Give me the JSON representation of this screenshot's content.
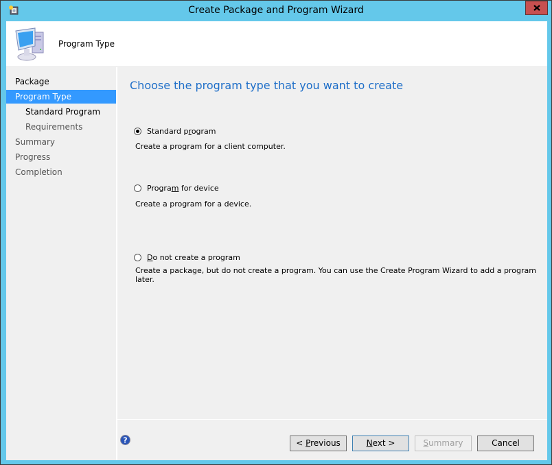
{
  "window": {
    "title": "Create Package and Program Wizard",
    "app_icon": "wizard-app-icon",
    "close_icon": "close-icon"
  },
  "header": {
    "icon": "computer-icon",
    "title": "Program Type"
  },
  "sidebar": {
    "items": [
      {
        "label": "Package",
        "state": "normal"
      },
      {
        "label": "Program Type",
        "state": "selected"
      },
      {
        "label": "Standard Program",
        "state": "sub"
      },
      {
        "label": "Requirements",
        "state": "sub-muted"
      },
      {
        "label": "Summary",
        "state": "muted"
      },
      {
        "label": "Progress",
        "state": "muted"
      },
      {
        "label": "Completion",
        "state": "muted"
      }
    ]
  },
  "main": {
    "heading": "Choose the program type that you want to create",
    "options": [
      {
        "label_pre": "Standard p",
        "label_accel": "r",
        "label_post": "ogram",
        "description": "Create a program for a client computer.",
        "checked": true
      },
      {
        "label_pre": "Progra",
        "label_accel": "m",
        "label_post": " for device",
        "description": "Create a program for a device.",
        "checked": false
      },
      {
        "label_pre": "",
        "label_accel": "D",
        "label_post": "o not create a program",
        "description": "Create a package, but do not create a program. You can use the Create Program Wizard to add a program later.",
        "checked": false
      }
    ]
  },
  "footer": {
    "help_icon": "help-icon",
    "previous": {
      "pre": "< ",
      "accel": "P",
      "post": "revious"
    },
    "next": {
      "pre": "",
      "accel": "N",
      "post": "ext >"
    },
    "summary": {
      "pre": "",
      "accel": "S",
      "post": "ummary",
      "disabled": true
    },
    "cancel": {
      "label": "Cancel"
    }
  },
  "colors": {
    "window_frame": "#64c8ea",
    "close_button": "#c75050",
    "selected_nav": "#3399ff",
    "heading": "#1e6ec8"
  }
}
